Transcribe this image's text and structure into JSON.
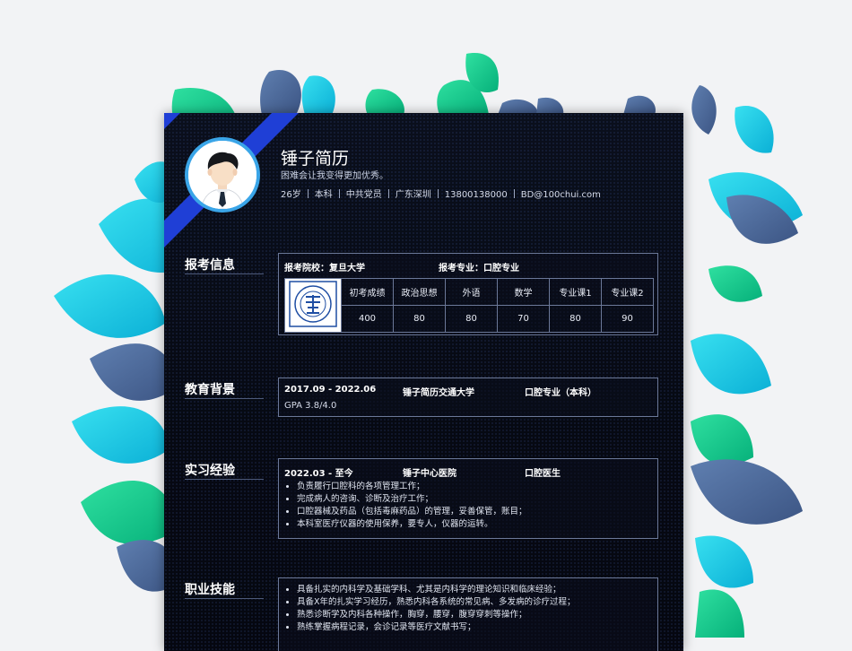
{
  "colors": {
    "accent_blue": "#1f3fd6",
    "avatar_ring": "#3aa5e8",
    "leaf_cyan": "#1bc8e0",
    "leaf_green": "#12c98a",
    "leaf_slate": "#4a6492",
    "panel_bg": "#080c18",
    "border": "#6b7898"
  },
  "header": {
    "name": "锤子简历",
    "tagline": "困难会让我变得更加优秀。",
    "info": [
      "26岁",
      "本科",
      "中共党员",
      "广东深圳",
      "13800138000",
      "BD@100chui.com"
    ]
  },
  "exam": {
    "title": "报考信息",
    "school": "报考院校：复旦大学",
    "major": "报考专业：口腔专业",
    "logo_icon": "university-seal-icon",
    "headers": [
      "初考成绩",
      "政治思想",
      "外语",
      "数学",
      "专业课1",
      "专业课2"
    ],
    "scores": [
      "400",
      "80",
      "80",
      "70",
      "80",
      "90"
    ]
  },
  "education": {
    "title": "教育背景",
    "period": "2017.09 - 2022.06",
    "school": "锤子简历交通大学",
    "degree": "口腔专业（本科）",
    "gpa": "GPA 3.8/4.0"
  },
  "internship": {
    "title": "实习经验",
    "period": "2022.03 - 至今",
    "org": "锤子中心医院",
    "role": "口腔医生",
    "items": [
      "负责履行口腔科的各项管理工作；",
      "完成病人的咨询、诊断及治疗工作；",
      "口腔器械及药品（包括毒麻药品）的管理，妥善保管，账目；",
      "本科室医疗仪器的使用保养，要专人，仪器的运转。"
    ]
  },
  "skills": {
    "title": "职业技能",
    "items": [
      "具备扎实的内科学及基础学科、尤其是内科学的理论知识和临床经验；",
      "具备X年的扎实学习经历，熟悉内科各系统的常见病、多发病的诊疗过程；",
      "熟悉诊断学及内科各种操作，胸穿，腰穿，腹穿穿刺等操作；",
      "熟练掌握病程记录，会诊记录等医疗文献书写；"
    ]
  }
}
